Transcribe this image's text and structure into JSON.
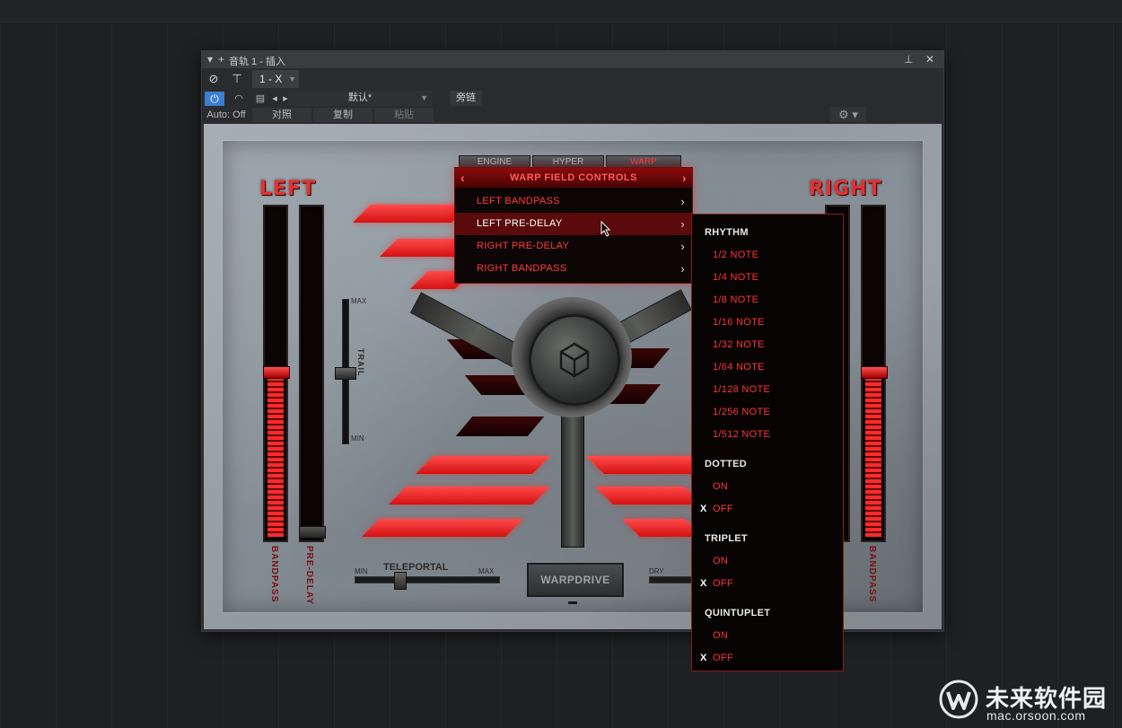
{
  "window": {
    "title": "音轨 1 - 插入",
    "tab_label": "1 - X"
  },
  "toolbar": {
    "auto_label": "Auto: Off",
    "preset_name": "默认*",
    "sidechain_label": "旁链",
    "compare_label": "对照",
    "copy_label": "复制",
    "paste_label": "粘贴"
  },
  "plugin": {
    "left_title": "LEFT",
    "right_title": "RIGHT",
    "tabs": [
      "ENGINE",
      "HYPER",
      "WARP"
    ],
    "trail_label": "TRAIL",
    "trail_max": "MAX",
    "trail_min": "MIN",
    "teleportal_label": "TELEPORTAL",
    "teleportal_min": "MIN",
    "teleportal_max": "MAX",
    "dry_label": "DRY",
    "warpdrive_label": "WARPDRIVE",
    "left_bandpass_label": "BANDPASS",
    "left_predelay_label": "PRE-DELAY",
    "right_bandpass_label": "BANDPASS"
  },
  "menu": {
    "header": "WARP FIELD CONTROLS",
    "items": [
      "LEFT BANDPASS",
      "LEFT PRE-DELAY",
      "RIGHT PRE-DELAY",
      "RIGHT BANDPASS"
    ]
  },
  "submenu": {
    "rhythm_header": "RHYTHM",
    "rhythm_items": [
      "1/2 NOTE",
      "1/4 NOTE",
      "1/8 NOTE",
      "1/16 NOTE",
      "1/32 NOTE",
      "1/64 NOTE",
      "1/128 NOTE",
      "1/256 NOTE",
      "1/512 NOTE"
    ],
    "dotted_header": "DOTTED",
    "dotted_on": "ON",
    "dotted_off": "OFF",
    "triplet_header": "TRIPLET",
    "triplet_on": "ON",
    "triplet_off": "OFF",
    "quintuplet_header": "QUINTUPLET",
    "quintuplet_on": "ON",
    "quintuplet_off": "OFF",
    "check_mark": "X"
  },
  "watermark": {
    "brand": "未来软件园",
    "url": "mac.orsoon.com"
  },
  "colors": {
    "accent_red": "#ff3434",
    "highlight_blue": "#3a7fd0"
  },
  "icons": [
    "collapse-arrow-icon",
    "add-icon",
    "pin-icon",
    "close-icon",
    "routing-icon",
    "network-icon",
    "power-icon",
    "automation-icon",
    "preset-file-icon",
    "prev-icon",
    "next-icon",
    "gear-icon",
    "cube-logo-icon"
  ]
}
